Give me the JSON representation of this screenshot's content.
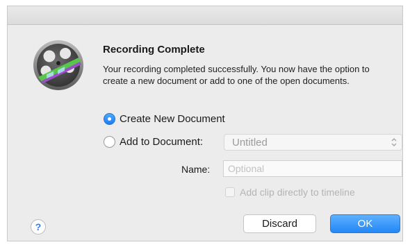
{
  "dialog": {
    "title": "Recording Complete",
    "message": "Your recording completed successfully.  You now have the option to create a new document or add to one of the open documents.",
    "app_icon": "camtasia-film-reel-icon"
  },
  "options": {
    "create_new_label": "Create New Document",
    "create_new_selected": true,
    "add_to_label": "Add to Document:",
    "add_to_selected": false,
    "document_select_value": "Untitled"
  },
  "name_field": {
    "label": "Name:",
    "placeholder": "Optional",
    "value": ""
  },
  "add_clip_checkbox": {
    "label": "Add clip directly to timeline",
    "checked": false,
    "enabled": false
  },
  "buttons": {
    "help_label": "?",
    "discard_label": "Discard",
    "ok_label": "OK"
  },
  "colors": {
    "accent": "#2287f5",
    "dialog_background": "#ececec"
  }
}
